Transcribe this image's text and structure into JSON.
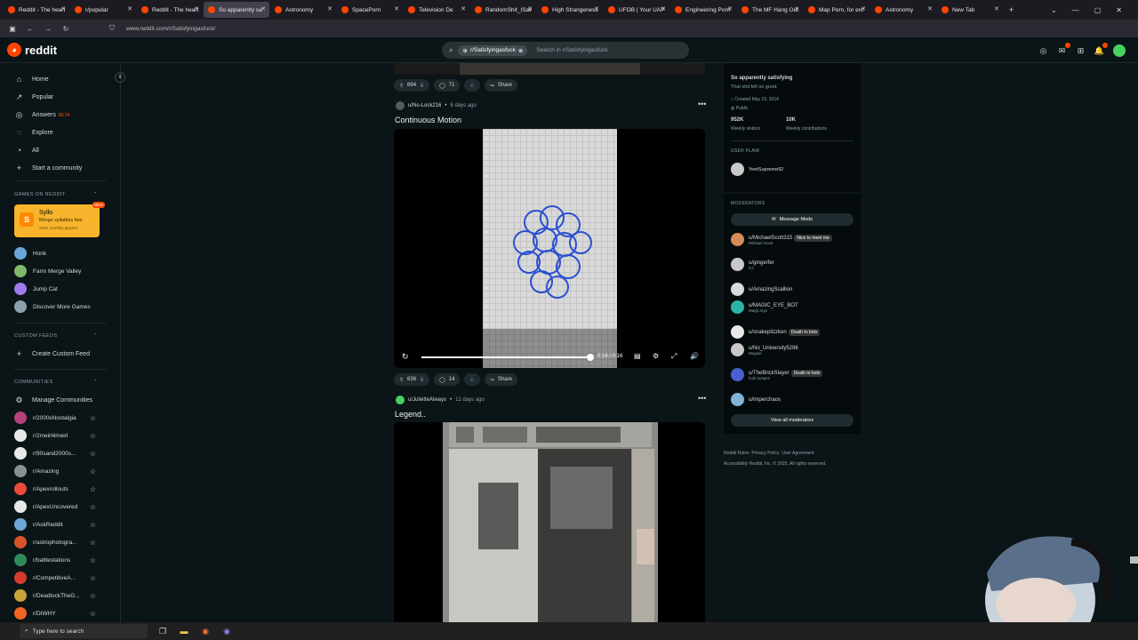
{
  "browser": {
    "tabs": [
      {
        "label": "Reddit - The heart",
        "active": false
      },
      {
        "label": "r/popular",
        "active": false
      },
      {
        "label": "Reddit - The heart",
        "active": false
      },
      {
        "label": "So apparently sa",
        "active": true
      },
      {
        "label": "Astronomy",
        "active": false
      },
      {
        "label": "SpacePorn",
        "active": false
      },
      {
        "label": "Television De",
        "active": false
      },
      {
        "label": "RandomShit_ISaw",
        "active": false
      },
      {
        "label": "High Strangeness",
        "active": false
      },
      {
        "label": "UFOB | Your UAP",
        "active": false
      },
      {
        "label": "Engineering Porn",
        "active": false
      },
      {
        "label": "The MF Hang Out",
        "active": false
      },
      {
        "label": "Map Porn, for ent",
        "active": false
      },
      {
        "label": "Astronomy",
        "active": false
      },
      {
        "label": "New Tab",
        "active": false
      }
    ],
    "new_tab": "+",
    "url": "www.reddit.com/r/Satisfyingasfuck/"
  },
  "header": {
    "logo_text": "reddit",
    "search_chip": "r/Satisfyingasfuck",
    "search_placeholder": "Search in r/Satisfyingasfuck"
  },
  "sidebar": {
    "nav": [
      {
        "label": "Home",
        "icon": "home-icon"
      },
      {
        "label": "Popular",
        "icon": "popular-icon"
      },
      {
        "label": "Answers",
        "icon": "answers-icon",
        "badge": "BETA"
      },
      {
        "label": "Explore",
        "icon": "explore-icon"
      },
      {
        "label": "All",
        "icon": "all-icon"
      },
      {
        "label": "Start a community",
        "icon": "plus-icon"
      }
    ],
    "games_header": "GAMES ON REDDIT",
    "featured_game": {
      "title": "Syllo",
      "subtitle": "Merge syllables fast",
      "players": "334K monthly players",
      "badge": "NEW"
    },
    "games": [
      "Honk",
      "Farm Merge Valley",
      "Jump Cat",
      "Discover More Games"
    ],
    "custom_feeds_header": "CUSTOM FEEDS",
    "create_feed": "Create Custom Feed",
    "communities_header": "COMMUNITIES",
    "manage": "Manage Communities",
    "communities": [
      {
        "name": "r/2000sNostalgia",
        "color": "#b5427a"
      },
      {
        "name": "r/2meirl4meirl",
        "color": "#e8e8e8"
      },
      {
        "name": "r/90sand2000s...",
        "color": "#e8e8e8"
      },
      {
        "name": "r/Amazing",
        "color": "#8a8f8f"
      },
      {
        "name": "r/Apexrollouts",
        "color": "#e84b3c"
      },
      {
        "name": "r/ApexUncovered",
        "color": "#e8e8e8"
      },
      {
        "name": "r/AskReddit",
        "color": "#6aa7d8"
      },
      {
        "name": "r/astrophotogra...",
        "color": "#d9532b"
      },
      {
        "name": "r/battlestations",
        "color": "#2e8b57"
      },
      {
        "name": "r/CompetitiveA...",
        "color": "#d43b2b"
      },
      {
        "name": "r/DeadlockTheG...",
        "color": "#c9a23a"
      },
      {
        "name": "r/DIWHY",
        "color": "#f26522"
      }
    ]
  },
  "feed": {
    "top_post_actions": {
      "votes": "694",
      "comments": "71",
      "share": "Share"
    },
    "post1": {
      "author": "u/No-Lock216",
      "ago": "6 days ago",
      "title": "Continuous Motion",
      "time": "0:16 / 0:16",
      "votes": "636",
      "comments": "14",
      "share": "Share"
    },
    "post2": {
      "author": "u/JulietteAlways",
      "ago": "12 days ago",
      "title": "Legend.."
    }
  },
  "right": {
    "community_title": "So apparently satisfying",
    "community_desc": "That shit felt so good.",
    "created": "Created May 15, 2014",
    "visibility": "Public",
    "visitors_value": "952K",
    "visitors_label": "Weekly visitors",
    "contrib_value": "10K",
    "contrib_label": "Weekly contributions",
    "user_flair_header": "USER FLAIR",
    "user_flair": "YeetSupreme92",
    "moderators_header": "MODERATORS",
    "message_mods": "Message Mods",
    "moderators": [
      {
        "name": "u/MichaelScott315",
        "flair": "Michael Scott",
        "tag": "Nice to meet me",
        "color": "#d68a5c"
      },
      {
        "name": "u/gingerfer",
        "flair": "CJ",
        "tag": "",
        "color": "#c9c9c9"
      },
      {
        "name": "u/AmazingScallion",
        "flair": "",
        "tag": "",
        "color": "#d7dadc"
      },
      {
        "name": "u/MAGIC_EYE_BOT",
        "flair": "Magic Eye",
        "tag": "",
        "color": "#2bb5a8"
      },
      {
        "name": "u/snakeplizzken",
        "flair": "",
        "tag": "Death to bots",
        "color": "#e8e8e8"
      },
      {
        "name": "u/No_University5296",
        "flair": "Mugsie",
        "tag": "",
        "color": "#c9c9c9"
      },
      {
        "name": "u/TheBrickSlayer",
        "flair": "fuck /u/spez",
        "tag": "Death to bots",
        "color": "#4a5fd1"
      },
      {
        "name": "u/imperchaos",
        "flair": "",
        "tag": "",
        "color": "#7fb3d8"
      }
    ],
    "view_all": "View all moderators",
    "footer_links": [
      "Reddit Rules",
      "Privacy Policy",
      "User Agreement"
    ],
    "footer_line2": "Accessibility   Reddit, Inc. © 2025. All rights reserved."
  },
  "taskbar": {
    "search_placeholder": "Type here to search"
  }
}
